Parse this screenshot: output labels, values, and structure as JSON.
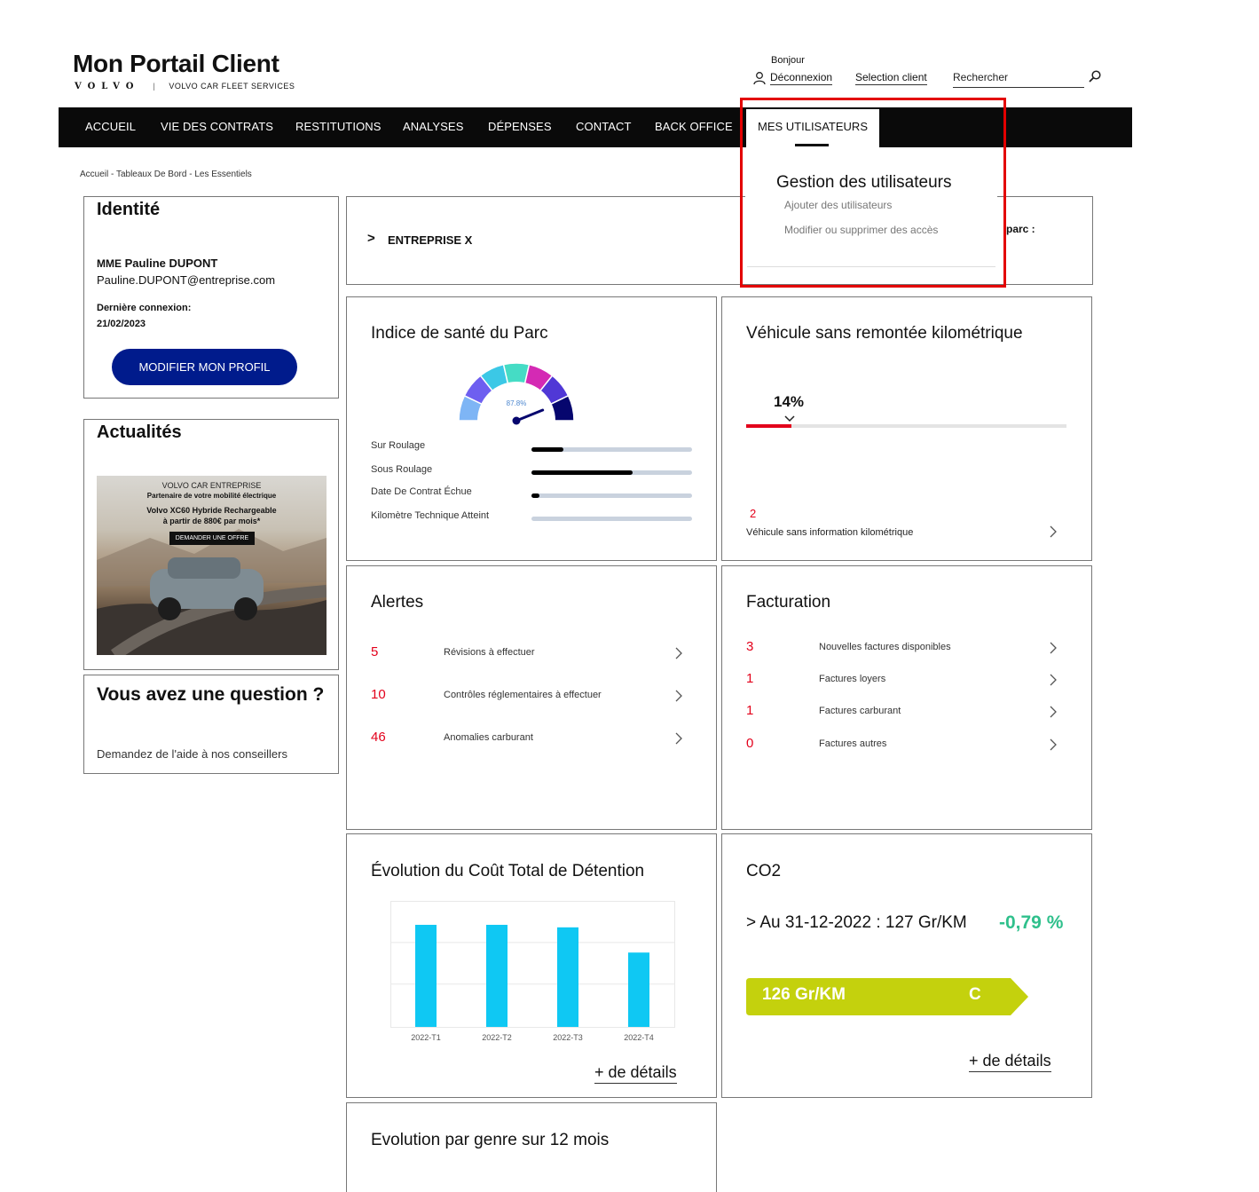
{
  "header": {
    "title": "Mon Portail Client",
    "brand": "VOLVO",
    "brand_sub": "VOLVO CAR FLEET SERVICES",
    "hello": "Bonjour",
    "logout": "Déconnexion",
    "select_client": "Selection client",
    "search_placeholder": "Rechercher"
  },
  "nav": {
    "items": [
      "ACCUEIL",
      "VIE DES CONTRATS",
      "RESTITUTIONS",
      "ANALYSES",
      "DÉPENSES",
      "CONTACT",
      "BACK OFFICE",
      "MES UTILISATEURS"
    ]
  },
  "dropdown": {
    "title": "Gestion des utilisateurs",
    "links": [
      "Ajouter des utilisateurs",
      "Modifier ou supprimer des accès"
    ]
  },
  "breadcrumb": "Accueil - Tableaux De Bord - Les Essentiels",
  "identity": {
    "title": "Identité",
    "civility": "MME",
    "name": "Pauline DUPONT",
    "email": "Pauline.DUPONT@entreprise.com",
    "last_login_label": "Dernière connexion:",
    "last_login": "21/02/2023",
    "edit_button": "MODIFIER MON PROFIL"
  },
  "company": {
    "name": "ENTREPRISE X",
    "partial_label": "parc :"
  },
  "news": {
    "title": "Actualités",
    "ad_line1": "VOLVO CAR ENTREPRISE",
    "ad_line2": "Partenaire de votre mobilité électrique",
    "ad_line3": "Volvo XC60 Hybride Rechargeable",
    "ad_line4": "à partir de 880€ par mois*",
    "ad_button": "DEMANDER UNE OFFRE"
  },
  "question": {
    "title": "Vous avez une question ?",
    "text": "Demandez de l'aide à nos conseillers"
  },
  "health": {
    "title": "Indice de santé du Parc",
    "gauge_value": "87.8%",
    "gauge_fraction": 0.878,
    "colors": [
      "#7eb5f5",
      "#6e5ff0",
      "#3bc8e6",
      "#45dcc5",
      "#d42ab4",
      "#5038d6",
      "#06066e"
    ],
    "rows": [
      {
        "label": "Sur Roulage",
        "fraction": 0.2
      },
      {
        "label": "Sous Roulage",
        "fraction": 0.63
      },
      {
        "label": "Date De Contrat Échue",
        "fraction": 0.05
      },
      {
        "label": "Kilomètre Technique Atteint",
        "fraction": 0.0
      }
    ]
  },
  "mileage": {
    "title": "Véhicule sans remontée kilométrique",
    "percent": "14%",
    "fraction": 0.14,
    "count": "2",
    "label": "Véhicule sans information kilométrique"
  },
  "alerts": {
    "title": "Alertes",
    "items": [
      {
        "count": "5",
        "label": "Révisions à effectuer"
      },
      {
        "count": "10",
        "label": "Contrôles réglementaires à effectuer"
      },
      {
        "count": "46",
        "label": "Anomalies carburant"
      }
    ]
  },
  "billing": {
    "title": "Facturation",
    "items": [
      {
        "count": "3",
        "label": "Nouvelles factures disponibles"
      },
      {
        "count": "1",
        "label": "Factures loyers"
      },
      {
        "count": "1",
        "label": "Factures carburant"
      },
      {
        "count": "0",
        "label": "Factures autres"
      }
    ]
  },
  "tco": {
    "title": "Évolution du Coût Total de Détention",
    "details": "+ de détails"
  },
  "chart_data": {
    "type": "bar",
    "categories": [
      "2022-T1",
      "2022-T2",
      "2022-T3",
      "2022-T4"
    ],
    "values": [
      81,
      81,
      79,
      59
    ],
    "ylim": [
      0,
      100
    ],
    "color": "#0fc8f3",
    "grid": true
  },
  "co2": {
    "title": "CO2",
    "date_line": "> Au 31-12-2022 : 127 Gr/KM",
    "change": "-0,79 %",
    "badge_value": "126 Gr/KM",
    "badge_class": "C",
    "badge_color": "#c4d10d",
    "change_color": "#2fc08c",
    "details": "+ de détails"
  },
  "genre": {
    "title": "Evolution par genre sur 12 mois"
  }
}
